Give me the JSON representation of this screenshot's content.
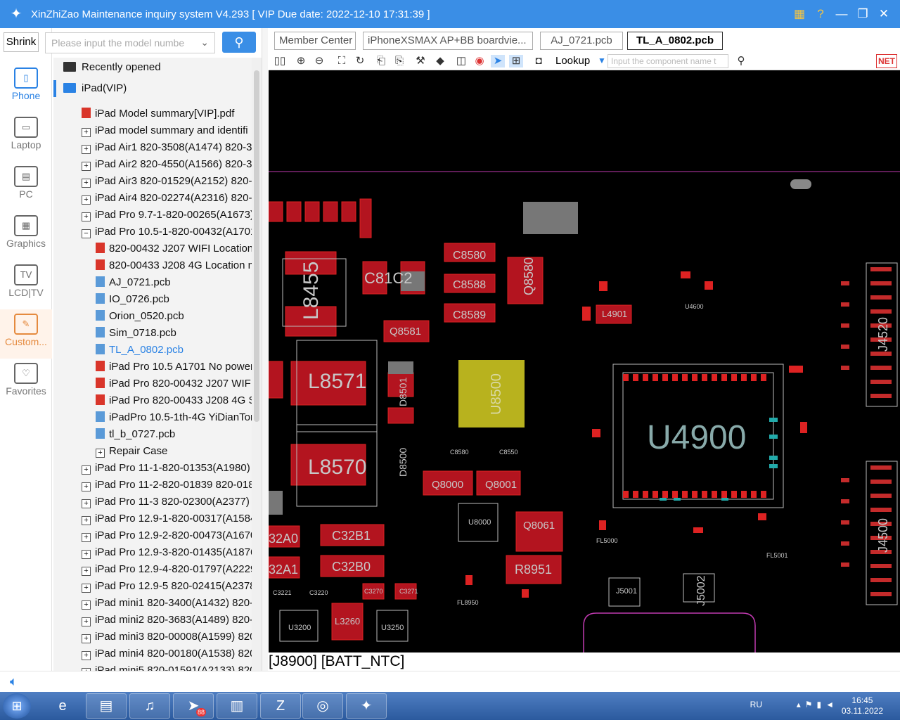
{
  "window": {
    "title": "XinZhiZao Maintenance inquiry system V4.293 [ VIP Due date: 2022-12-10 17:31:39 ]"
  },
  "icons": {
    "logo": "star-logo-icon",
    "calendar": "calendar-icon",
    "help": "help-icon",
    "minimize": "minimize-icon",
    "maximize": "maximize-icon",
    "close": "close-icon"
  },
  "sidebar": {
    "shrink_label": "Shrink",
    "categories": [
      {
        "label": "Phone",
        "icon": "phone-icon"
      },
      {
        "label": "Laptop",
        "icon": "laptop-icon"
      },
      {
        "label": "PC",
        "icon": "pc-icon"
      },
      {
        "label": "Graphics",
        "icon": "graphics-card-icon"
      },
      {
        "label": "LCD|TV",
        "icon": "tv-icon"
      },
      {
        "label": "Custom...",
        "icon": "custom-pencil-icon"
      },
      {
        "label": "Favorites",
        "icon": "favorites-folder-icon"
      }
    ]
  },
  "search": {
    "placeholder": "Please input the model numbe"
  },
  "tree": {
    "recent": "Recently opened",
    "ipad": "iPad(VIP)",
    "items": [
      {
        "label": "iPad Model summary[VIP].pdf",
        "type": "pdf",
        "level": 1
      },
      {
        "label": "iPad model summary and identifi",
        "type": "plus",
        "level": 1
      },
      {
        "label": "iPad Air1 820-3508(A1474) 820-3",
        "type": "plus",
        "level": 1
      },
      {
        "label": "iPad Air2 820-4550(A1566) 820-3",
        "type": "plus",
        "level": 1
      },
      {
        "label": "iPad Air3 820-01529(A2152) 820-0",
        "type": "plus",
        "level": 1
      },
      {
        "label": "iPad Air4 820-02274(A2316) 820-0",
        "type": "plus",
        "level": 1
      },
      {
        "label": "iPad Pro 9.7-1-820-00265(A1673)",
        "type": "plus",
        "level": 1
      },
      {
        "label": "iPad Pro 10.5-1-820-00432(A1701",
        "type": "minus",
        "level": 1
      },
      {
        "label": "820-00432 J207 WIFI Location",
        "type": "pdf",
        "level": 2
      },
      {
        "label": "820-00433 J208 4G Location m",
        "type": "pdf",
        "level": 2
      },
      {
        "label": "AJ_0721.pcb",
        "type": "pcb",
        "level": 2
      },
      {
        "label": "IO_0726.pcb",
        "type": "pcb",
        "level": 2
      },
      {
        "label": "Orion_0520.pcb",
        "type": "pcb",
        "level": 2
      },
      {
        "label": "Sim_0718.pcb",
        "type": "pcb",
        "level": 2
      },
      {
        "label": "TL_A_0802.pcb",
        "type": "pcb",
        "level": 2,
        "selected": true
      },
      {
        "label": "iPad Pro 10.5 A1701 No power",
        "type": "pdf",
        "level": 2
      },
      {
        "label": "iPad Pro 820-00432 J207 WIFI",
        "type": "pdf",
        "level": 2
      },
      {
        "label": "iPad Pro 820-00433 J208 4G Sc",
        "type": "pdf",
        "level": 2
      },
      {
        "label": "iPadPro 10.5-1th-4G YiDianTor",
        "type": "pcb",
        "level": 2
      },
      {
        "label": "tl_b_0727.pcb",
        "type": "pcb",
        "level": 2
      },
      {
        "label": "Repair Case",
        "type": "plus",
        "level": 2
      },
      {
        "label": "iPad Pro 11-1-820-01353(A1980)",
        "type": "plus",
        "level": 1
      },
      {
        "label": "iPad Pro 11-2-820-01839 820-018",
        "type": "plus",
        "level": 1
      },
      {
        "label": "iPad Pro 11-3 820-02300(A2377) 8",
        "type": "plus",
        "level": 1
      },
      {
        "label": "iPad Pro 12.9-1-820-00317(A1584",
        "type": "plus",
        "level": 1
      },
      {
        "label": "iPad Pro 12.9-2-820-00473(A1670",
        "type": "plus",
        "level": 1
      },
      {
        "label": "iPad Pro 12.9-3-820-01435(A1876",
        "type": "plus",
        "level": 1
      },
      {
        "label": "iPad Pro 12.9-4-820-01797(A2229",
        "type": "plus",
        "level": 1
      },
      {
        "label": "iPad Pro 12.9-5 820-02415(A2378",
        "type": "plus",
        "level": 1
      },
      {
        "label": "iPad mini1 820-3400(A1432) 820-",
        "type": "plus",
        "level": 1
      },
      {
        "label": "iPad mini2 820-3683(A1489) 820-",
        "type": "plus",
        "level": 1
      },
      {
        "label": "iPad mini3 820-00008(A1599) 820",
        "type": "plus",
        "level": 1
      },
      {
        "label": "iPad mini4 820-00180(A1538) 820",
        "type": "plus",
        "level": 1
      },
      {
        "label": "iPad mini5 820-01591(A2133) 820",
        "type": "plus",
        "level": 1
      }
    ]
  },
  "tabs": [
    {
      "label": "Member Center"
    },
    {
      "label": "iPhoneXSMAX AP+BB boardvie..."
    },
    {
      "label": "AJ_0721.pcb"
    },
    {
      "label": "TL_A_0802.pcb",
      "active": true
    }
  ],
  "toolbar": {
    "lookup_label": "Lookup",
    "component_placeholder": "Input the component name t",
    "net_label": "NET"
  },
  "pcb": {
    "labels": [
      "L8455",
      "C81C2",
      "Q8580",
      "C8580",
      "C8588",
      "C8589",
      "Q8581",
      "L4901",
      "U4600",
      "L8571",
      "U8500",
      "D8501",
      "D8500",
      "L8570",
      "Q8000",
      "Q8001",
      "U8000",
      "Q8061",
      "R8951",
      "C32B1",
      "C32B0",
      "32A0",
      "32A1",
      "L3260",
      "U3200",
      "U3250",
      "U4900",
      "J4520",
      "J4500",
      "J5001",
      "J5002",
      "FL5000",
      "FL5001",
      "FL8950",
      "C8580",
      "C8550",
      "C3270",
      "C3271",
      "C3221",
      "C3220"
    ]
  },
  "status": {
    "text": "[J8900] [BATT_NTC]"
  },
  "taskbar": {
    "lang": "RU",
    "time": "16:45",
    "date": "03.11.2022",
    "badge": "88"
  }
}
